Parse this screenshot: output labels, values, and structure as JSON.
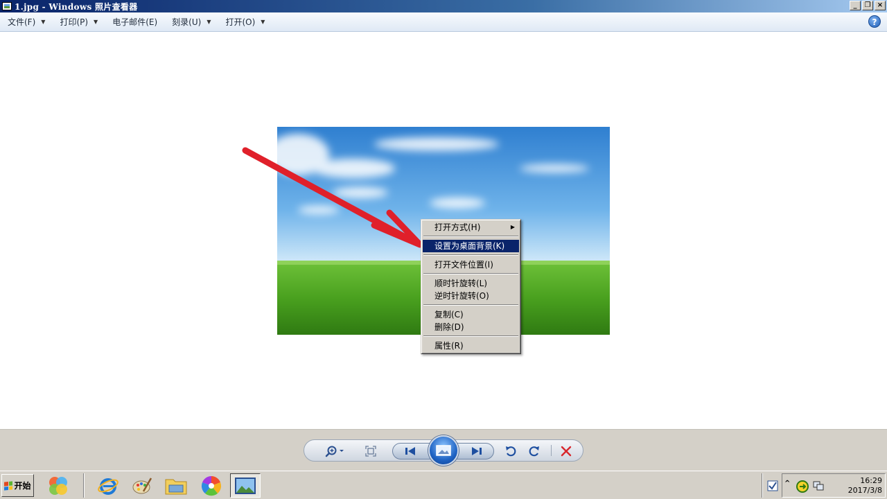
{
  "window": {
    "title": "1.jpg - Windows 照片查看器",
    "controls": [
      "minimize-icon",
      "restore-icon",
      "close-icon"
    ]
  },
  "menubar": {
    "items": [
      {
        "label": "文件(F)",
        "has_dropdown": true
      },
      {
        "label": "打印(P)",
        "has_dropdown": true
      },
      {
        "label": "电子邮件(E)",
        "has_dropdown": false
      },
      {
        "label": "刻录(U)",
        "has_dropdown": true
      },
      {
        "label": "打开(O)",
        "has_dropdown": true
      }
    ],
    "help_label": "?"
  },
  "context_menu": {
    "items": [
      {
        "label": "打开方式(H)",
        "submenu": true
      },
      {
        "label": "设置为桌面背景(K)",
        "highlighted": true
      },
      {
        "label": "打开文件位置(I)"
      },
      {
        "label": "顺时针旋转(L)"
      },
      {
        "label": "逆时针旋转(O)"
      },
      {
        "label": "复制(C)"
      },
      {
        "label": "删除(D)"
      },
      {
        "label": "属性(R)"
      }
    ]
  },
  "controls": {
    "icons": [
      "zoom-icon",
      "fit-window-icon",
      "previous-icon",
      "slideshow-icon",
      "next-icon",
      "rotate-counterclockwise-icon",
      "rotate-clockwise-icon",
      "delete-icon"
    ]
  },
  "taskbar": {
    "start_label": "开始",
    "clock_time": "16:29",
    "clock_date": "2017/3/8"
  },
  "colors": {
    "highlight": "#0a246a",
    "annotation_arrow": "#e0202a",
    "chrome": "#d4d0c8"
  }
}
